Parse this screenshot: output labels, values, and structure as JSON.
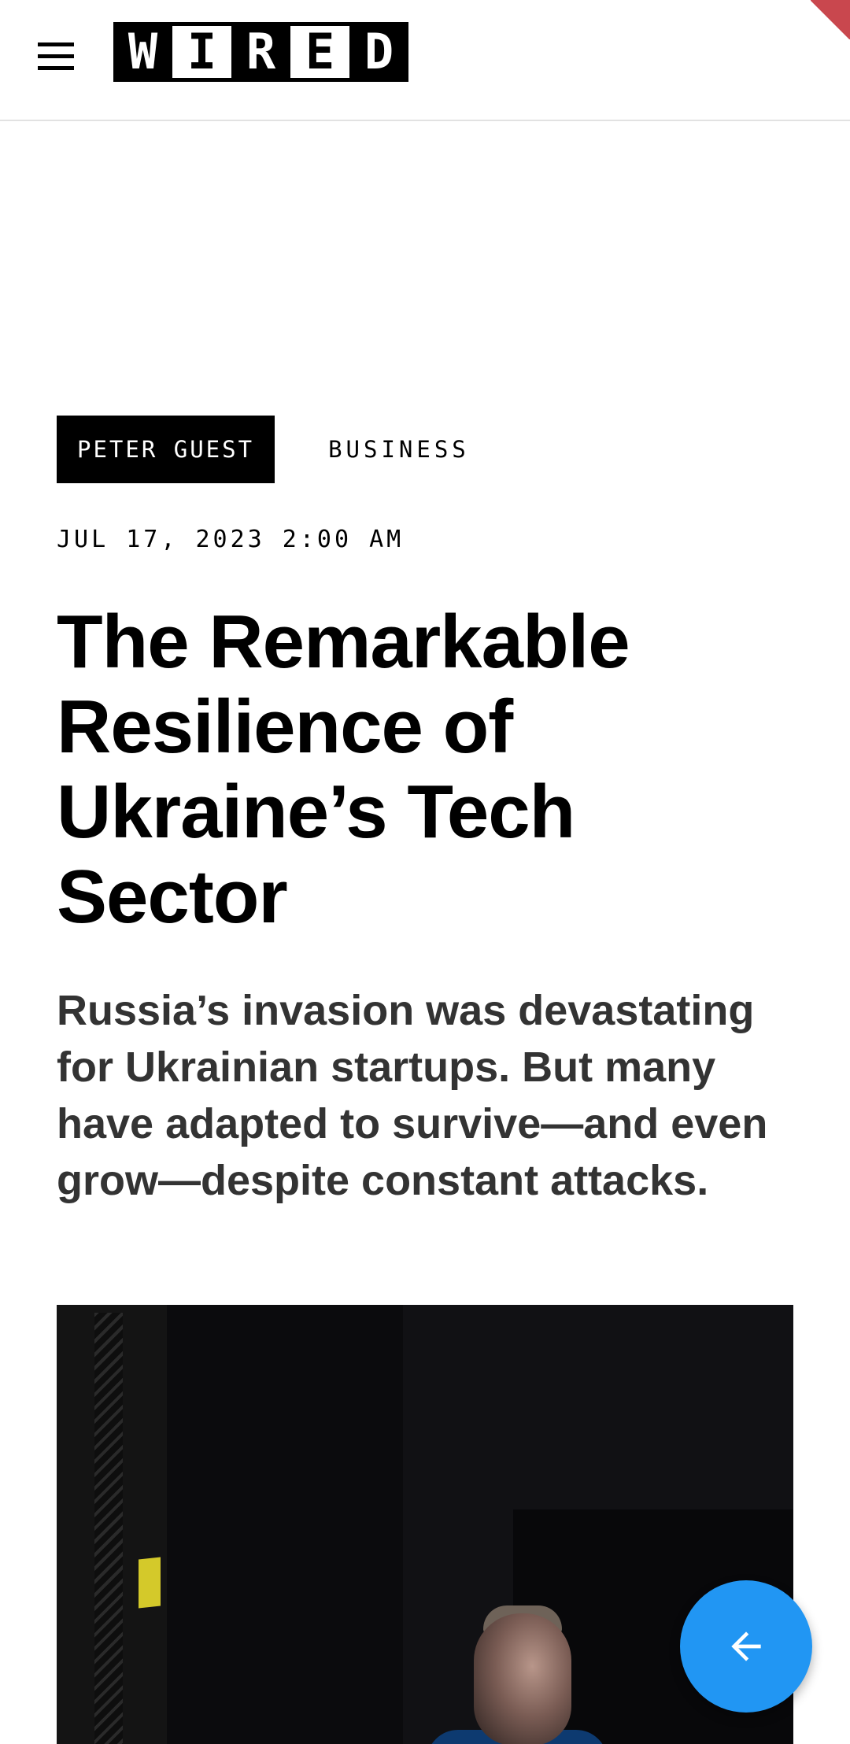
{
  "header": {
    "logo_letters": [
      "W",
      "I",
      "R",
      "E",
      "D"
    ],
    "logo_text": "WIRED",
    "menu_icon": "hamburger-menu-icon"
  },
  "article": {
    "author": "PETER GUEST",
    "section": "BUSINESS",
    "date": "JUL 17, 2023 2:00 AM",
    "headline": "The Remarkable Resilience of Ukraine’s Tech Sector",
    "dek": "Russia’s invasion was devastating for Ukrainian startups. But many have adapted to survive—and even grow—despite constant attacks."
  },
  "fab": {
    "icon": "arrow-left-icon"
  },
  "colors": {
    "background": "#ffffff",
    "text": "#000000",
    "dek_text": "#333333",
    "fab_blue": "#2196f3",
    "corner_accent": "#c9474e"
  }
}
